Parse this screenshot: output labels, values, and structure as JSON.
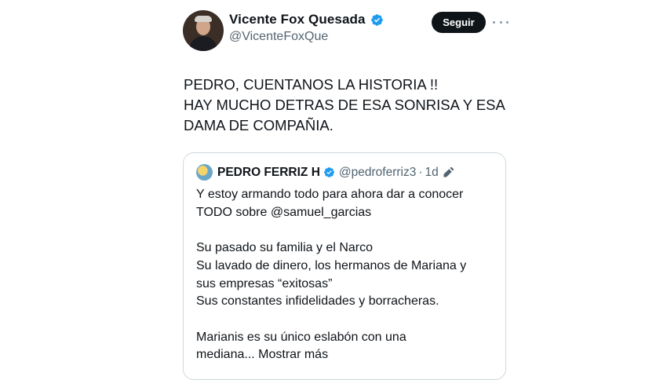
{
  "author": {
    "display_name": "Vicente Fox Quesada",
    "handle": "@VicenteFoxQue"
  },
  "follow_label": "Seguir",
  "tweet_lines": [
    "PEDRO, CUENTANOS LA HISTORIA !!",
    "HAY MUCHO DETRAS DE ESA SONRISA Y ESA",
    "DAMA DE COMPAÑIA."
  ],
  "quote": {
    "display_name": "PEDRO FERRIZ H",
    "handle": "@pedroferriz3",
    "separator": "·",
    "time": "1d",
    "lines": [
      "Y estoy armando todo para ahora dar a conocer",
      "TODO sobre @samuel_garcias",
      "",
      "Su pasado su familia y  el Narco",
      "Su lavado de dinero, los hermanos de Mariana y",
      "sus empresas “exitosas”",
      "Sus constantes infidelidades y borracheras.",
      "",
      "Marianis es su único eslabón con una",
      "mediana..."
    ],
    "show_more": "Mostrar más"
  },
  "colors": {
    "verified": "#1d9bf0",
    "button_bg": "#0f1419",
    "secondary_text": "#536471",
    "border": "#cfd9de"
  },
  "icons": [
    "verified-badge-icon",
    "more-options-icon",
    "edit-icon"
  ]
}
